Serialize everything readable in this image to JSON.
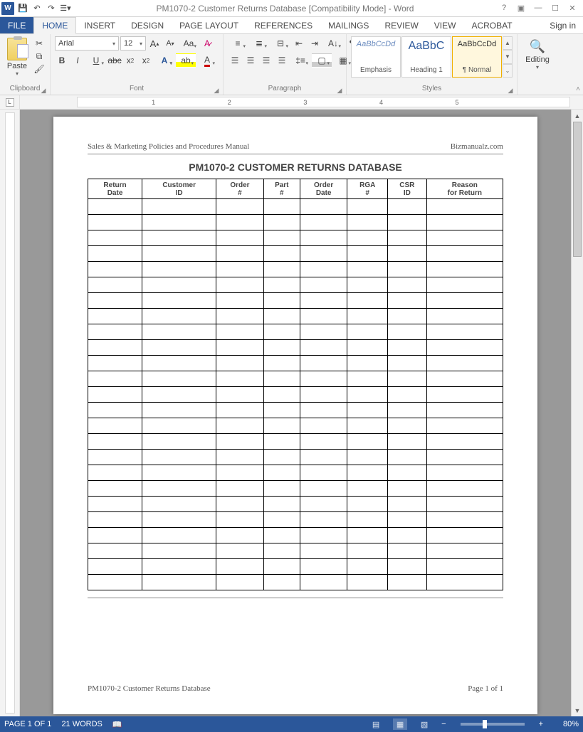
{
  "titlebar": {
    "title": "PM1070-2 Customer Returns Database [Compatibility Mode] - Word"
  },
  "tabs": {
    "file": "FILE",
    "items": [
      "HOME",
      "INSERT",
      "DESIGN",
      "PAGE LAYOUT",
      "REFERENCES",
      "MAILINGS",
      "REVIEW",
      "VIEW",
      "ACROBAT"
    ],
    "active_index": 0,
    "signin": "Sign in"
  },
  "ribbon": {
    "clipboard": {
      "paste": "Paste",
      "label": "Clipboard"
    },
    "font": {
      "name": "Arial",
      "size": "12",
      "label": "Font"
    },
    "paragraph": {
      "label": "Paragraph"
    },
    "styles": {
      "label": "Styles",
      "items": [
        {
          "sample": "AaBbCcDd",
          "name": "Emphasis",
          "css": "font-style:italic;color:#6a8bbf;font-size:11px;"
        },
        {
          "sample": "AaBbC",
          "name": "Heading 1",
          "css": "color:#2b579a;font-size:16px;"
        },
        {
          "sample": "AaBbCcDd",
          "name": "¶ Normal",
          "css": "color:#333;font-size:11px;"
        }
      ],
      "selected_index": 2
    },
    "editing": {
      "label": "Editing"
    }
  },
  "ruler": {
    "numbers": [
      "1",
      "2",
      "3",
      "4",
      "5"
    ]
  },
  "document": {
    "header_left": "Sales & Marketing Policies and Procedures Manual",
    "header_right": "Bizmanualz.com",
    "title": "PM1070-2 CUSTOMER RETURNS DATABASE",
    "columns": [
      "Return Date",
      "Customer ID",
      "Order #",
      "Part #",
      "Order Date",
      "RGA #",
      "CSR ID",
      "Reason for Return"
    ],
    "blank_rows": 25,
    "footer_left": "PM1070-2 Customer Returns Database",
    "footer_right": "Page 1 of 1"
  },
  "statusbar": {
    "page": "PAGE 1 OF 1",
    "words": "21 WORDS",
    "zoom": "80%"
  }
}
